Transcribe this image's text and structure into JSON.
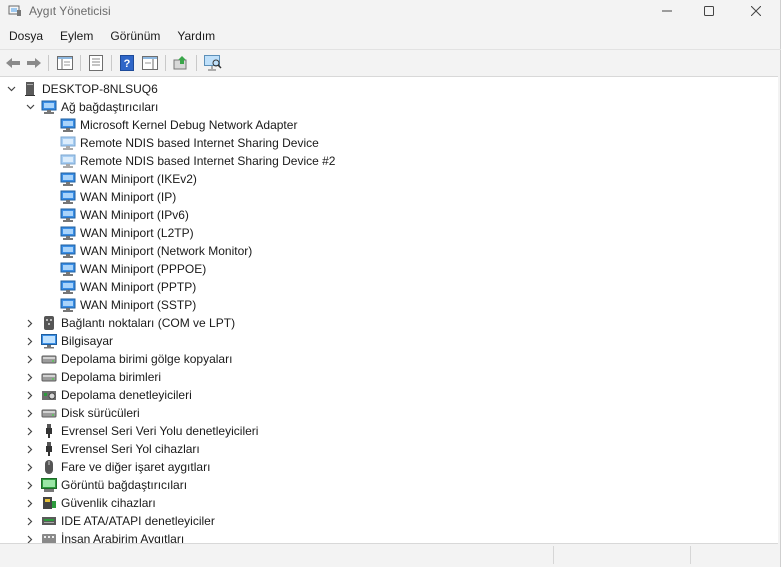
{
  "window": {
    "title": "Aygıt Yöneticisi"
  },
  "menu": [
    "Dosya",
    "Eylem",
    "Görünüm",
    "Yardım"
  ],
  "colors": {
    "accent": "#2f7fd1",
    "net_icon": "#3a8ee6"
  },
  "tree": {
    "root": "DESKTOP-8NLSUQ6",
    "network_category": "Ağ bağdaştırıcıları",
    "network_adapters": [
      "Microsoft Kernel Debug Network Adapter",
      "Remote NDIS based Internet Sharing Device",
      "Remote NDIS based Internet Sharing Device #2",
      "WAN Miniport (IKEv2)",
      "WAN Miniport (IP)",
      "WAN Miniport (IPv6)",
      "WAN Miniport (L2TP)",
      "WAN Miniport (Network Monitor)",
      "WAN Miniport (PPPOE)",
      "WAN Miniport (PPTP)",
      "WAN Miniport (SSTP)"
    ],
    "categories": [
      {
        "label": "Bağlantı noktaları (COM ve LPT)",
        "icon": "port-icon"
      },
      {
        "label": "Bilgisayar",
        "icon": "computer-icon"
      },
      {
        "label": "Depolama birimi gölge kopyaları",
        "icon": "drive-icon"
      },
      {
        "label": "Depolama birimleri",
        "icon": "drive-icon"
      },
      {
        "label": "Depolama denetleyicileri",
        "icon": "storage-controller-icon"
      },
      {
        "label": "Disk sürücüleri",
        "icon": "drive-icon"
      },
      {
        "label": "Evrensel Seri Veri Yolu denetleyicileri",
        "icon": "usb-icon"
      },
      {
        "label": "Evrensel Seri Yol cihazları",
        "icon": "usb-icon"
      },
      {
        "label": "Fare ve diğer işaret aygıtları",
        "icon": "mouse-icon"
      },
      {
        "label": "Görüntü bağdaştırıcıları",
        "icon": "display-adapter-icon"
      },
      {
        "label": "Güvenlik cihazları",
        "icon": "security-device-icon"
      },
      {
        "label": "IDE ATA/ATAPI denetleyiciler",
        "icon": "ide-icon"
      },
      {
        "label": "İnsan Arabirim Aygıtları",
        "icon": "hid-icon"
      }
    ]
  }
}
